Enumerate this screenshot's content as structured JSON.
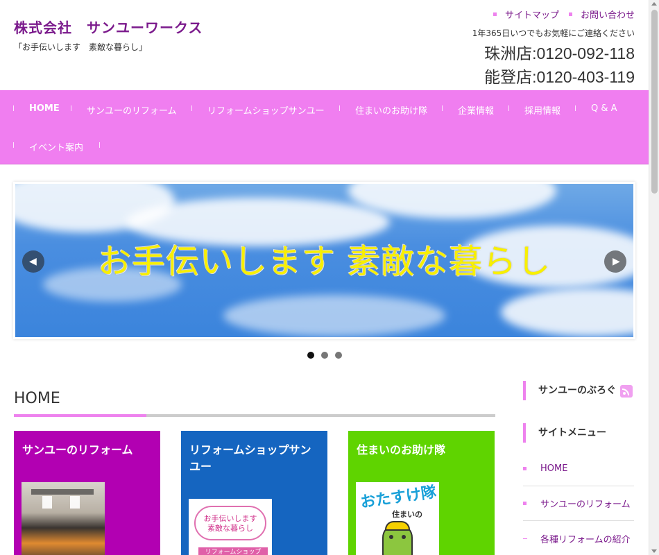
{
  "header": {
    "site_title": "株式会社　サンユーワークス",
    "site_description": "「お手伝いします　素敵な暮らし」",
    "util_links": [
      "サイトマップ",
      "お問い合わせ"
    ],
    "contact_note": "1年365日いつでもお気軽にご連絡ください",
    "phone_shusu": "珠洲店:0120-092-118",
    "phone_noto": "能登店:0120-403-119"
  },
  "nav": {
    "items": [
      "HOME",
      "サンユーのリフォーム",
      "リフォームショップサンユー",
      "住まいのお助け隊",
      "企業情報",
      "採用情報",
      "Q & A",
      "イベント案内"
    ]
  },
  "slider": {
    "caption": "お手伝いします  素敵な暮らし",
    "prev_glyph": "◀",
    "next_glyph": "▶",
    "dot_count": 3,
    "active_dot": 1
  },
  "main": {
    "page_heading": "HOME",
    "cards": [
      {
        "title": "サンユーのリフォーム",
        "color": "#b200b2"
      },
      {
        "title": "リフォームショップサンユー",
        "color": "#1565c0"
      },
      {
        "title": "住まいのお助け隊",
        "color": "#5fd400"
      }
    ],
    "card2_thumb_text": [
      "お手伝いします",
      "素敵な暮らし",
      "リフォームショップ"
    ],
    "card3_thumb_text": [
      "おたすけ隊",
      "住まいの"
    ]
  },
  "sidebar": {
    "blog_title": "サンユーのぶろぐ",
    "menu_title": "サイトメニュー",
    "menu_items": [
      "HOME",
      "サンユーのリフォーム",
      "各種リフォームの紹介"
    ]
  },
  "colors": {
    "nav_bg": "#f07ef0",
    "brand_purple": "#7b1a8c",
    "accent_pink": "#ee82ee"
  }
}
